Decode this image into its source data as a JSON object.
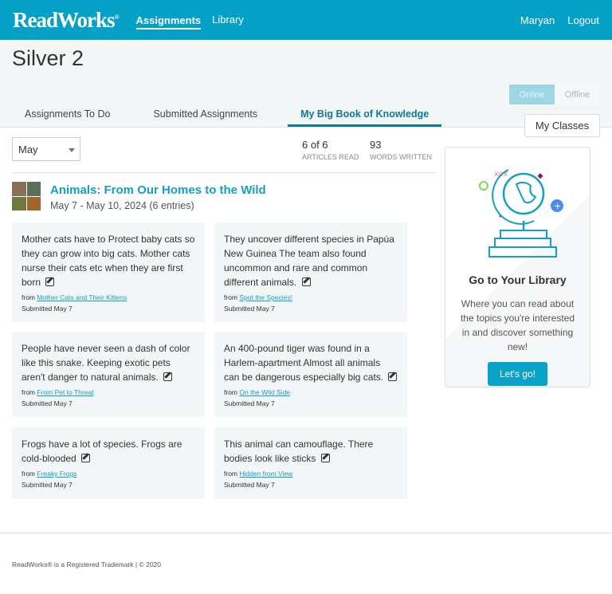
{
  "header": {
    "logo": "ReadWorks",
    "nav": [
      "Assignments",
      "Library"
    ],
    "user": "Maryan",
    "logout": "Logout"
  },
  "subheader": {
    "title": "Silver 2",
    "toggle": {
      "online": "Online",
      "offline": "Offline",
      "selected": "Online"
    },
    "my_classes": "My Classes",
    "tabs": [
      {
        "label": "Assignments To Do"
      },
      {
        "label": "Submitted Assignments"
      },
      {
        "label": "My Big Book of Knowledge",
        "active": true
      }
    ]
  },
  "filter": {
    "month": "May"
  },
  "stats": {
    "articles_value": "6 of 6",
    "articles_label": "ARTICLES READ",
    "words_value": "93",
    "words_label": "WORDS WRITTEN"
  },
  "unit": {
    "title": "Animals: From Our Homes to the Wild",
    "dates": "May 7 - May 10, 2024 (6 entries)"
  },
  "entries": [
    {
      "text": "Mother cats have to Protect baby cats so they can grow into big cats. Mother cats nurse their cats etc when they are first born",
      "from": "from",
      "article": "Mother Cats and Their Kittens",
      "submitted": "Submitted May 7"
    },
    {
      "text": "They uncover different species in Papúa New Guinea The team also found uncommon and rare and common different animals.",
      "from": "from",
      "article": "Spot the Species!",
      "submitted": "Submitted May 7"
    },
    {
      "text": "People have never seen a dash of color like this snake. Keeping exotic pets aren't danger to natural animals.",
      "from": "from",
      "article": "From Pet to Threat",
      "submitted": "Submitted May 7"
    },
    {
      "text": "An 400-pound tiger was found in a Harlem-apartment Almost all animals can be dangerous especially big cats.",
      "from": "from",
      "article": "On the Wild Side",
      "submitted": "Submitted May 7"
    },
    {
      "text": "Frogs have a lot of species. Frogs are cold-blooded",
      "from": "from",
      "article": "Freaky Frogs",
      "submitted": "Submitted May 7"
    },
    {
      "text": "This animal can camouflage. There bodies look like sticks",
      "from": "from",
      "article": "Hidden from View",
      "submitted": "Submitted May 7"
    }
  ],
  "library_card": {
    "title": "Go to Your Library",
    "text": "Where you can read about the topics you're interested in and discover something new!",
    "button": "Let's go!"
  },
  "footer": {
    "text": "ReadWorks® is a Registered Trademark | © 2020"
  }
}
